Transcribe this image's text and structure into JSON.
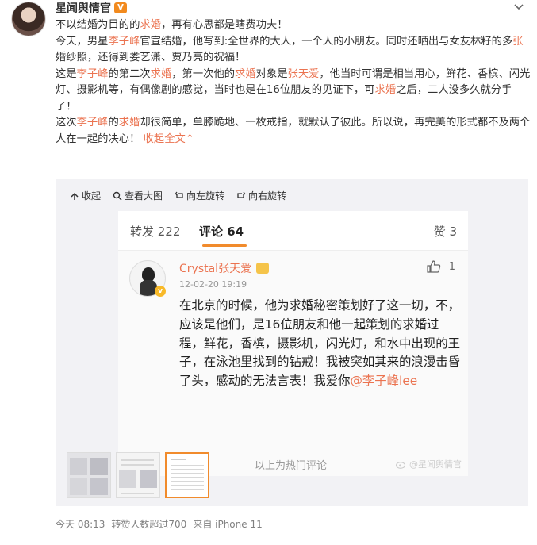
{
  "post": {
    "author": "星闻舆情官",
    "vip_badge": "V",
    "paragraphs": [
      [
        {
          "t": "不以结婚为目的的"
        },
        {
          "t": "求婚",
          "hl": true
        },
        {
          "t": "，再有心思都是瞎费功夫！"
        }
      ],
      [
        {
          "t": "今天，男星"
        },
        {
          "t": "李子峰",
          "hl": true
        },
        {
          "t": "官宣结婚，他写到:全世界的大人，一个人的小朋友。同时还晒出与女友林籽的多"
        },
        {
          "t": "张",
          "hl": true
        },
        {
          "t": "婚纱照，还得到娄艺潇、贾乃亮的祝福！"
        }
      ],
      [
        {
          "t": "这是"
        },
        {
          "t": "李子峰",
          "hl": true
        },
        {
          "t": "的第二次"
        },
        {
          "t": "求婚",
          "hl": true
        },
        {
          "t": "，第一次他的"
        },
        {
          "t": "求婚",
          "hl": true
        },
        {
          "t": "对象是"
        },
        {
          "t": "张天爱",
          "hl": true
        },
        {
          "t": "，他当时可谓是相当用心，鲜花、香槟、闪光灯、摄影机等，有偶像剧的感觉，当时也是在16位朋友的见证下，可"
        },
        {
          "t": "求婚",
          "hl": true
        },
        {
          "t": "之后，二人没多久就分手了！"
        }
      ],
      [
        {
          "t": "这次"
        },
        {
          "t": "李子峰",
          "hl": true
        },
        {
          "t": "的"
        },
        {
          "t": "求婚",
          "hl": true
        },
        {
          "t": "却很简单，单膝跪地、一枚戒指，就默认了彼此。所以说，再完美的形式都不及两个人在一起的决心！"
        },
        {
          "t": " 收起全文",
          "link": true
        },
        {
          "t": "⌃",
          "link": true
        }
      ]
    ],
    "meta": {
      "time": "今天 08:13",
      "likes": "转赞人数超过700",
      "source": "来自 iPhone 11"
    }
  },
  "media": {
    "toolbar": [
      {
        "label": "收起",
        "icon": "collapse-icon"
      },
      {
        "label": "查看大图",
        "icon": "zoom-icon"
      },
      {
        "label": "向左旋转",
        "icon": "rotate-left-icon"
      },
      {
        "label": "向右旋转",
        "icon": "rotate-right-icon"
      }
    ],
    "screenshot": {
      "tab_repost": "转发 222",
      "tab_comment": "评论 64",
      "tab_like": "赞 3",
      "commenter": "Crystal张天爱",
      "comment_time": "12-02-20 19:19",
      "comment_likes": "1",
      "comment_text": "在北京的时候，他为求婚秘密策划好了这一切，不，应该是他们，是16位朋友和他一起策划的求婚过程，鲜花，香槟，摄影机，闪光灯，和水中出现的王子，在泳池里找到的钻戒！我被突如其来的浪漫击昏了头，感动的无法言表！我爱你",
      "mention": "@李子峰lee",
      "footer": "以上为热门评论",
      "watermark": "@星闻舆情官"
    },
    "thumbnails": [
      {
        "name": "photo-collage-1",
        "active": false
      },
      {
        "name": "photo-collage-2",
        "active": false
      },
      {
        "name": "comment-screenshot",
        "active": true
      }
    ]
  }
}
